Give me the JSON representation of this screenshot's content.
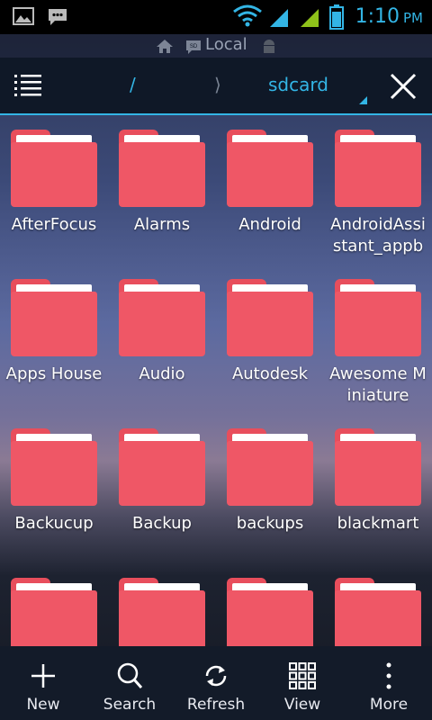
{
  "status_bar": {
    "time": "1:10",
    "ampm": "PM",
    "icons": [
      "gallery-icon",
      "chat-icon",
      "wifi-icon",
      "signal-icon",
      "signal-icon",
      "battery-icon"
    ]
  },
  "location": {
    "label": "Local",
    "icons": [
      "home-icon",
      "sd-card-icon",
      "android-icon"
    ]
  },
  "toolbar": {
    "root": "/",
    "separator": "⟩",
    "current": "sdcard",
    "accent": "#33b5e5"
  },
  "folders": [
    {
      "name": "AfterFocus"
    },
    {
      "name": "Alarms"
    },
    {
      "name": "Android"
    },
    {
      "name": "AndroidAssistant_appb"
    },
    {
      "name": "Apps House"
    },
    {
      "name": "Audio"
    },
    {
      "name": "Autodesk"
    },
    {
      "name": "Awesome Miniature"
    },
    {
      "name": "Backucup"
    },
    {
      "name": "Backup"
    },
    {
      "name": "backups"
    },
    {
      "name": "blackmart"
    },
    {
      "name": ""
    },
    {
      "name": ""
    },
    {
      "name": ""
    },
    {
      "name": ""
    }
  ],
  "folder_color": "#ef5766",
  "bottom_bar": [
    {
      "label": "New",
      "icon": "plus-icon"
    },
    {
      "label": "Search",
      "icon": "search-icon"
    },
    {
      "label": "Refresh",
      "icon": "refresh-icon"
    },
    {
      "label": "View",
      "icon": "grid-view-icon"
    },
    {
      "label": "More",
      "icon": "more-vertical-icon"
    }
  ]
}
